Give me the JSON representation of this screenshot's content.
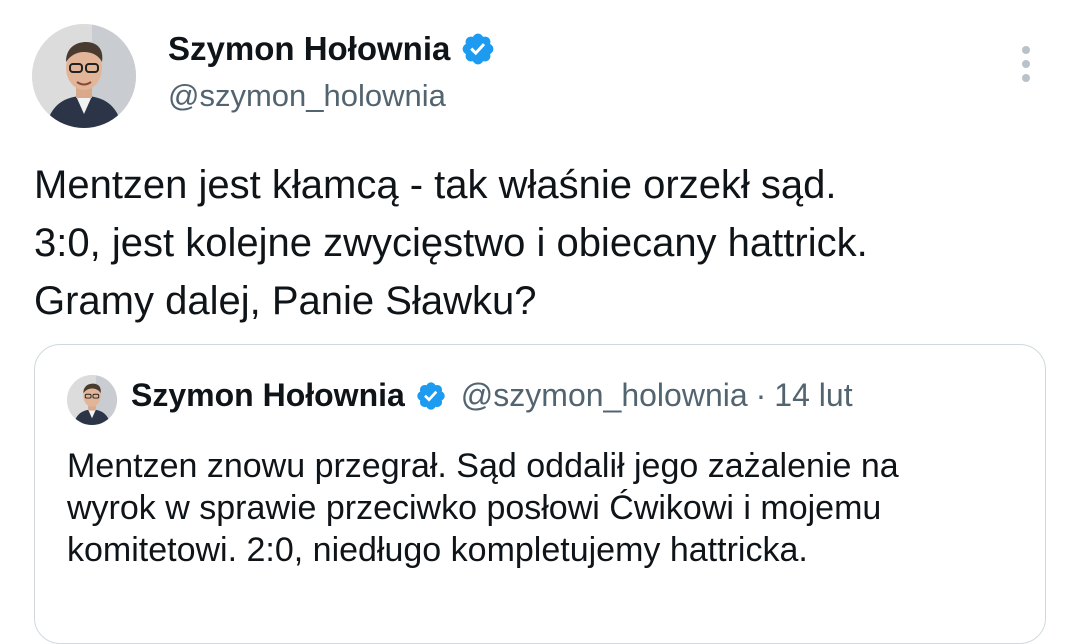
{
  "tweet": {
    "author": {
      "display_name": "Szymon Hołownia",
      "handle": "@szymon_holownia",
      "verified_icon": "verified-badge-icon",
      "badge_color": "#1d9bf0"
    },
    "more_icon": "more-vertical-icon",
    "text_lines": [
      "Mentzen jest kłamcą - tak właśnie orzekł sąd.",
      "3:0, jest kolejne zwycięstwo i obiecany hattrick.",
      "Gramy dalej, Panie Sławku?"
    ]
  },
  "quoted_tweet": {
    "author": {
      "display_name": "Szymon Hołownia",
      "handle": "@szymon_holownia",
      "verified_icon": "verified-badge-icon"
    },
    "separator": "·",
    "date": "14 lut",
    "text_lines": [
      "Mentzen znowu przegrał. Sąd oddalił jego zażalenie na",
      "wyrok w sprawie przeciwko posłowi Ćwikowi i mojemu",
      "komitetowi. 2:0, niedługo kompletujemy hattricka."
    ]
  }
}
